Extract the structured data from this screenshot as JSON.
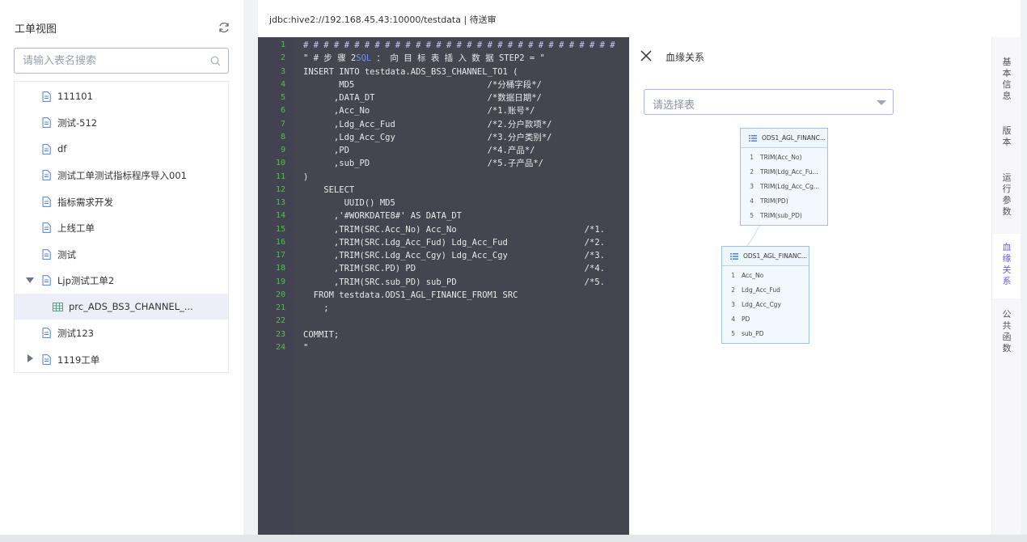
{
  "sidebar": {
    "title": "工单视图",
    "search_placeholder": "请输入表名搜索",
    "tree": [
      {
        "label": "111101",
        "kind": "doc"
      },
      {
        "label": "测试-512",
        "kind": "doc"
      },
      {
        "label": "df",
        "kind": "doc"
      },
      {
        "label": "测试工单测试指标程序导入001",
        "kind": "doc"
      },
      {
        "label": "指标需求开发",
        "kind": "doc"
      },
      {
        "label": "上线工单",
        "kind": "doc"
      },
      {
        "label": "测试",
        "kind": "doc"
      },
      {
        "label": "Ljp测试工单2",
        "kind": "doc",
        "expanded": true
      },
      {
        "label": "prc_ADS_BS3_CHANNEL_...",
        "kind": "table",
        "selected": true
      },
      {
        "label": "测试123",
        "kind": "doc"
      },
      {
        "label": "1119工单",
        "kind": "doc",
        "collapsed": true
      }
    ]
  },
  "topbar": {
    "connection": "jdbc:hive2://192.168.45.43:10000/testdata   |   待送审"
  },
  "editor": {
    "lines": [
      {
        "n": "1",
        "text": "# # # # # # # # # # # # # # # # # # # # # # # # # # # # # # #"
      },
      {
        "n": "2",
        "text": "\" # 步 骤 2SQL ： 向 目 标 表 插 入 数 据 STEP2 = \""
      },
      {
        "n": "3",
        "text": "INSERT INTO testdata.ADS_BS3_CHANNEL_TO1 ("
      },
      {
        "n": "4",
        "text": "       MD5                          /*分桶字段*/"
      },
      {
        "n": "5",
        "text": "      ,DATA_DT                      /*数据日期*/"
      },
      {
        "n": "6",
        "text": "      ,Acc_No                       /*1.账号*/"
      },
      {
        "n": "7",
        "text": "      ,Ldg_Acc_Fud                  /*2.分户款项*/"
      },
      {
        "n": "8",
        "text": "      ,Ldg_Acc_Cgy                  /*3.分户类别*/"
      },
      {
        "n": "9",
        "text": "      ,PD                           /*4.产品*/"
      },
      {
        "n": "10",
        "text": "      ,sub_PD                       /*5.子产品*/"
      },
      {
        "n": "11",
        "text": ")"
      },
      {
        "n": "12",
        "text": "    SELECT"
      },
      {
        "n": "13",
        "text": "        UUID() MD5"
      },
      {
        "n": "14",
        "text": "      ,'#WORKDATE8#' AS DATA_DT"
      },
      {
        "n": "15",
        "text": "      ,TRIM(SRC.Acc_No) Acc_No                         /*1."
      },
      {
        "n": "16",
        "text": "      ,TRIM(SRC.Ldg_Acc_Fud) Ldg_Acc_Fud               /*2."
      },
      {
        "n": "17",
        "text": "      ,TRIM(SRC.Ldg_Acc_Cgy) Ldg_Acc_Cgy               /*3."
      },
      {
        "n": "18",
        "text": "      ,TRIM(SRC.PD) PD                                 /*4."
      },
      {
        "n": "19",
        "text": "      ,TRIM(SRC.sub_PD) sub_PD                         /*5."
      },
      {
        "n": "20",
        "text": "  FROM testdata.ODS1_AGL_FINANCE_FROM1 SRC"
      },
      {
        "n": "21",
        "text": "    ;"
      },
      {
        "n": "22",
        "text": ""
      },
      {
        "n": "23",
        "text": "COMMIT;"
      },
      {
        "n": "24",
        "text": "\""
      }
    ]
  },
  "lineage": {
    "title": "血缘关系",
    "select_placeholder": "请选择表",
    "nodes": [
      {
        "title": "ODS1_AGL_FINANC...",
        "rows": [
          {
            "n": "1",
            "label": "TRIM(Acc_No)"
          },
          {
            "n": "2",
            "label": "TRIM(Ldg_Acc_Fu..."
          },
          {
            "n": "3",
            "label": "TRIM(Ldg_Acc_Cg..."
          },
          {
            "n": "4",
            "label": "TRIM(PD)"
          },
          {
            "n": "5",
            "label": "TRIM(sub_PD)"
          }
        ]
      },
      {
        "title": "ODS1_AGL_FINANC...",
        "rows": [
          {
            "n": "1",
            "label": "Acc_No"
          },
          {
            "n": "2",
            "label": "Ldg_Acc_Fud"
          },
          {
            "n": "3",
            "label": "Ldg_Acc_Cgy"
          },
          {
            "n": "4",
            "label": "PD"
          },
          {
            "n": "5",
            "label": "sub_PD"
          }
        ]
      }
    ]
  },
  "right_tabs": [
    {
      "label": "基本信息"
    },
    {
      "label": "版本"
    },
    {
      "label": "运行参数"
    },
    {
      "label": "血缘关系",
      "active": true
    },
    {
      "label": "公共函数"
    }
  ],
  "colors": {
    "accent": "#6a5ce8",
    "editor_bg": "#45454f",
    "line_number": "#4fbf4f",
    "node_border": "#9cc2e6"
  }
}
